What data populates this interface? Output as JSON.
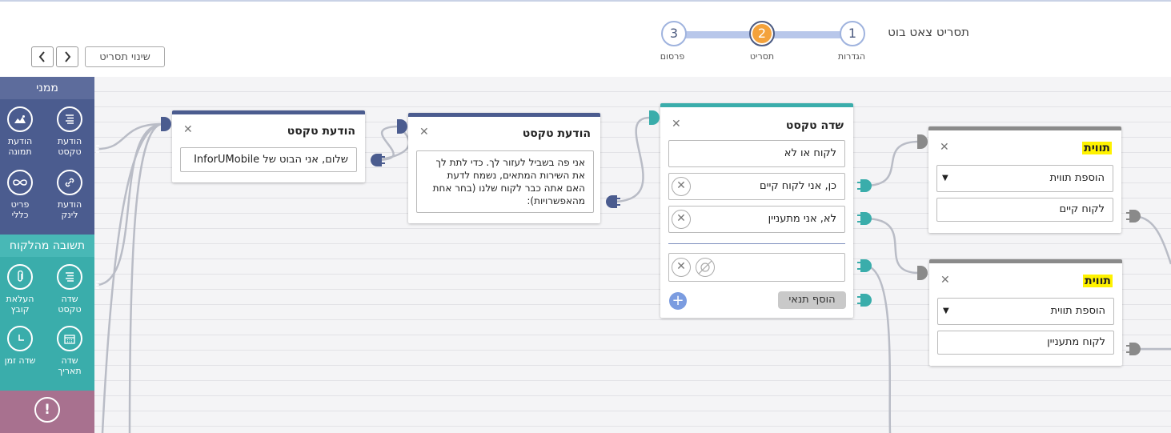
{
  "header": {
    "title": "תסריט צאט בוט",
    "steps": [
      {
        "number": "1",
        "label": "הגדרות",
        "state": "done"
      },
      {
        "number": "2",
        "label": "תסריט",
        "state": "active"
      },
      {
        "number": "3",
        "label": "פרסום",
        "state": "todo"
      }
    ],
    "rename_label": "שינוי תסריט",
    "prev_icon": "chevron-left-icon",
    "next_icon": "chevron-right-icon"
  },
  "palette": {
    "from_me": {
      "title": "ממני",
      "color": "#4b5c8f",
      "items": [
        {
          "label": "הודעת טקסט",
          "icon": "lines-icon"
        },
        {
          "label": "הודעת תמונה",
          "icon": "image-icon"
        },
        {
          "label": "הודעת לינק",
          "icon": "link-icon"
        },
        {
          "label": "פריט כללי",
          "icon": "infinity-icon"
        }
      ]
    },
    "from_customer": {
      "title": "תשובה מהלקוח",
      "color": "#3aadab",
      "items": [
        {
          "label": "שדה טקסט",
          "icon": "lines-icon"
        },
        {
          "label": "העלאת קובץ",
          "icon": "paperclip-icon"
        },
        {
          "label": "שדה תאריך",
          "icon": "calendar-icon"
        },
        {
          "label": "שדה זמן",
          "icon": "clock-icon"
        }
      ]
    },
    "error": {
      "color": "#a8718f",
      "icon": "exclamation-icon"
    }
  },
  "nodes": {
    "text_msg_1": {
      "title": "הודעת טקסט",
      "text": "שלום, אני הבוט של InforUMobile"
    },
    "text_msg_2": {
      "title": "הודעת טקסט",
      "text": "אני פה בשביל לעזור לך. כדי לתת לך את השירות המתאים, נשמח לדעת האם אתה כבר לקוח שלנו (בחר אחת מהאפשרויות):"
    },
    "text_field": {
      "title": "שדה טקסט",
      "question": "לקוח או לא",
      "options": [
        "כן, אני לקוח קיים",
        "לא, אני מתעניין"
      ],
      "add_condition": "הוסף תנאי"
    },
    "tag_1": {
      "title": "תווית",
      "select_placeholder": "הוספת תווית",
      "value": "לקוח קיים"
    },
    "tag_2": {
      "title": "תווית",
      "select_placeholder": "הוספת תווית",
      "value": "לקוח מתעניין"
    }
  },
  "colors": {
    "from_me_accent": "#4b5c8f",
    "customer_accent": "#3aadab",
    "tag_accent": "#8a8a8a",
    "step_active": "#f4a23b",
    "highlight": "#fff200"
  }
}
